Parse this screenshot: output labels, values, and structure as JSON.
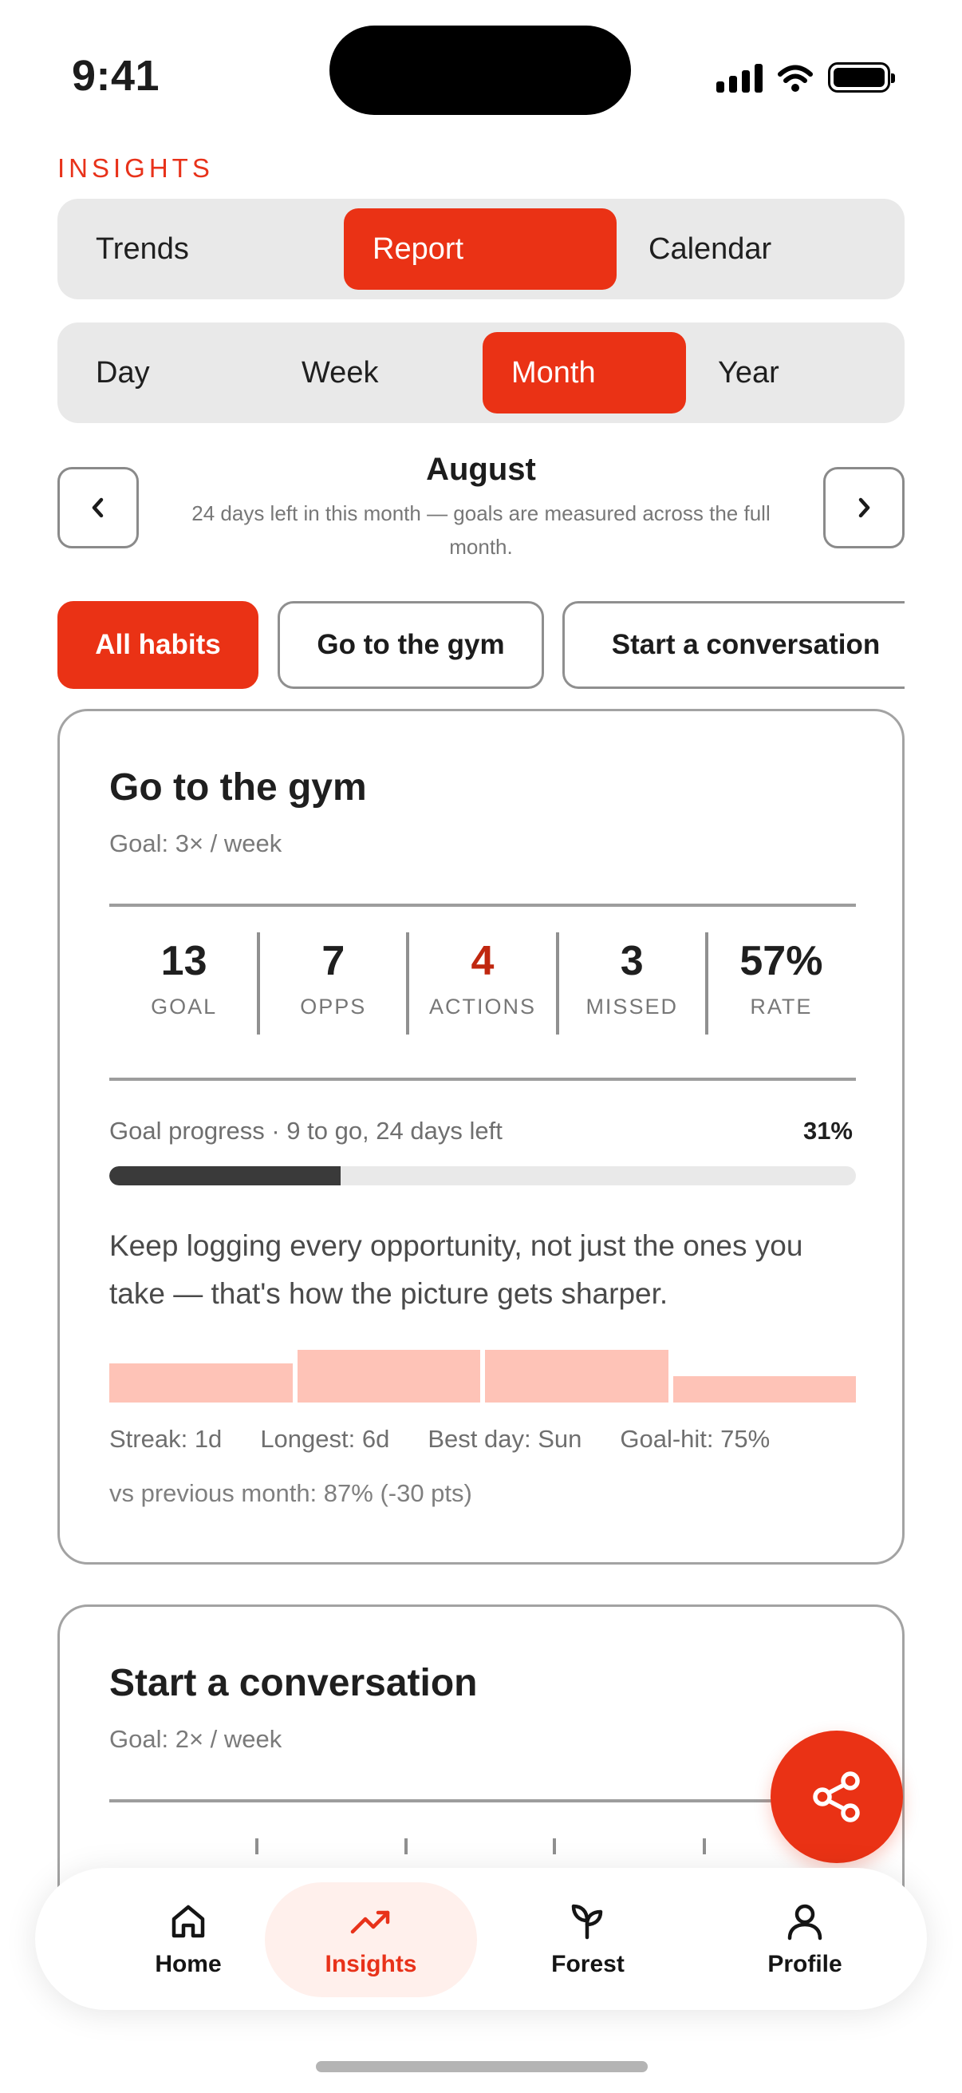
{
  "status_bar": {
    "time": "9:41"
  },
  "header": {
    "section_label": "INSIGHTS"
  },
  "view_tabs": [
    {
      "label": "Trends",
      "active": false
    },
    {
      "label": "Report",
      "active": true
    },
    {
      "label": "Calendar",
      "active": false
    }
  ],
  "period_tabs": [
    {
      "label": "Day",
      "active": false
    },
    {
      "label": "Week",
      "active": false
    },
    {
      "label": "Month",
      "active": true
    },
    {
      "label": "Year",
      "active": false
    }
  ],
  "period": {
    "title": "August",
    "subtitle": "24 days left in this month — goals are measured across the full month.",
    "prev_icon": "chevron-left-icon",
    "next_icon": "chevron-right-icon"
  },
  "habit_filters": [
    {
      "label": "All habits",
      "active": true
    },
    {
      "label": "Go to the gym",
      "active": false
    },
    {
      "label": "Start a conversation",
      "active": false
    }
  ],
  "cards": [
    {
      "title": "Go to the gym",
      "goal": "Goal: 3× / week",
      "stats": [
        {
          "value": "13",
          "label": "GOAL"
        },
        {
          "value": "7",
          "label": "OPPS"
        },
        {
          "value": "4",
          "label": "ACTIONS"
        },
        {
          "value": "3",
          "label": "MISSED"
        },
        {
          "value": "57%",
          "label": "RATE"
        }
      ],
      "progress_label": "Goal progress · 9 to go, 24 days left",
      "progress_pct": "31%",
      "progress_fraction": 0.31,
      "note": "Keep logging every opportunity, not just the ones you take — that's how the picture gets sharper.",
      "weekly_bars": [
        0.75,
        1.0,
        1.0,
        0.5
      ],
      "meta": [
        "Streak: 1d",
        "Longest: 6d",
        "Best day: Sun",
        "Goal-hit: 75%"
      ],
      "compare": "vs previous month: 87% (-30 pts)"
    },
    {
      "title": "Start a conversation",
      "goal": "Goal: 2× / week"
    }
  ],
  "fab": {
    "icon": "share-icon"
  },
  "tab_bar": [
    {
      "label": "Home",
      "icon": "home-icon",
      "active": false
    },
    {
      "label": "Insights",
      "icon": "trending-up-icon",
      "active": true
    },
    {
      "label": "Forest",
      "icon": "sprout-icon",
      "active": false
    },
    {
      "label": "Profile",
      "icon": "user-icon",
      "active": false
    }
  ],
  "colors": {
    "accent": "#EA3215",
    "accent_soft": "#FEC3B7",
    "accent_text": "#C0270F"
  }
}
